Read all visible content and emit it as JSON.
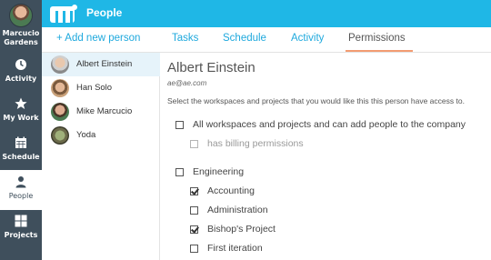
{
  "sidebar": {
    "user_name": "Marcucio\nGardens",
    "items": [
      {
        "label": "Activity",
        "icon": "activity-icon"
      },
      {
        "label": "My Work",
        "icon": "star-icon"
      },
      {
        "label": "Schedule",
        "icon": "calendar-icon"
      },
      {
        "label": "People",
        "icon": "person-icon",
        "active": true
      },
      {
        "label": "Projects",
        "icon": "grid-icon"
      }
    ]
  },
  "topbar": {
    "title": "People",
    "color": "#1fb7e6"
  },
  "tabs": {
    "add_person": "+ Add new person",
    "items": [
      "Tasks",
      "Schedule",
      "Activity",
      "Permissions"
    ],
    "active": "Permissions"
  },
  "people": [
    {
      "name": "Albert Einstein",
      "active": true
    },
    {
      "name": "Han Solo"
    },
    {
      "name": "Mike Marcucio"
    },
    {
      "name": "Yoda"
    }
  ],
  "detail": {
    "name": "Albert Einstein",
    "email": "ae@ae.com",
    "description": "Select the workspaces and projects that you would like this this person have access to.",
    "permissions": [
      {
        "label": "All workspaces and projects and can add people to the company",
        "checked": false
      },
      {
        "label": "has billing permissions",
        "checked": false,
        "disabled": true
      },
      {
        "label": "Engineering",
        "checked": false
      },
      {
        "label": "Accounting",
        "checked": true
      },
      {
        "label": "Administration",
        "checked": false
      },
      {
        "label": "Bishop's Project",
        "checked": true
      },
      {
        "label": "First iteration",
        "checked": false
      }
    ]
  }
}
